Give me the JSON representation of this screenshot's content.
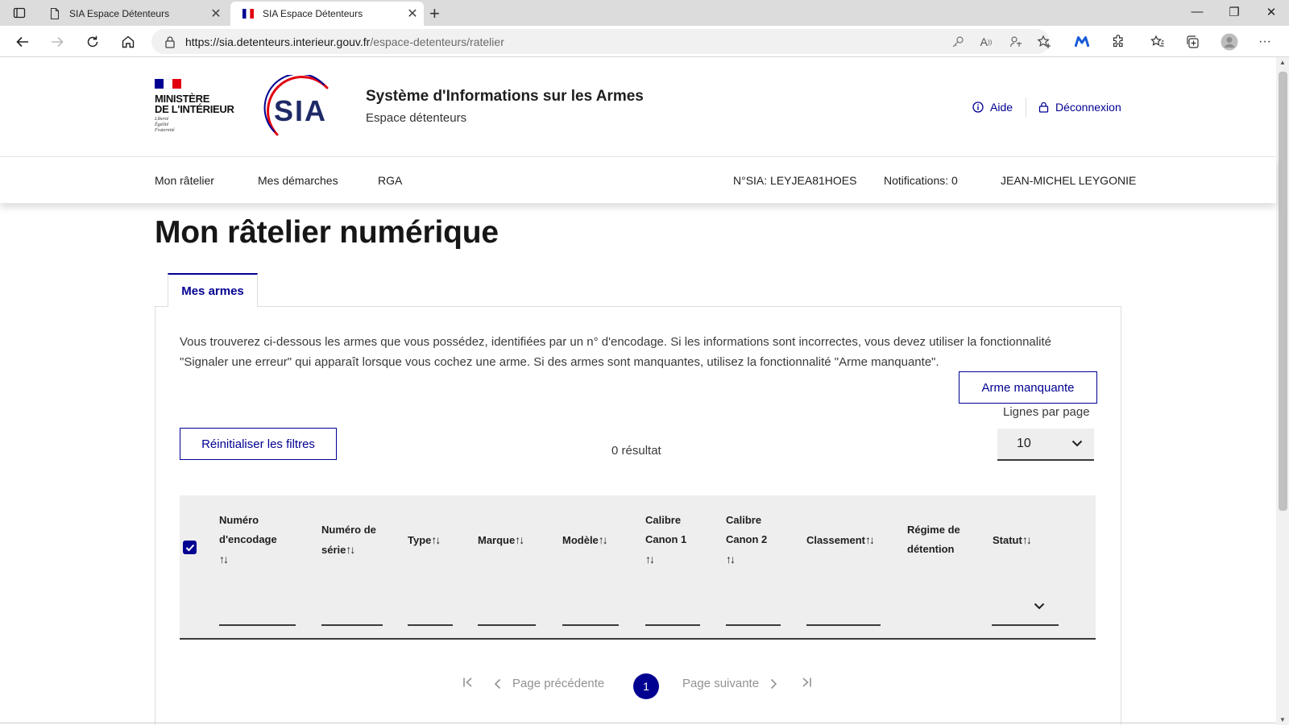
{
  "browser": {
    "tabs": [
      {
        "title": "SIA Espace Détenteurs",
        "active": false
      },
      {
        "title": "SIA Espace Détenteurs",
        "active": true
      }
    ],
    "url_host": "https://sia.detenteurs.interieur.gouv.fr",
    "url_path": "/espace-detenteurs/ratelier"
  },
  "header": {
    "ministere_line1": "MINISTÈRE",
    "ministere_line2": "DE L'INTÉRIEUR",
    "devise1": "Liberté",
    "devise2": "Égalité",
    "devise3": "Fraternité",
    "logo_text": "SIA",
    "title": "Système d'Informations sur les Armes",
    "subtitle": "Espace détenteurs",
    "help_label": "Aide",
    "logout_label": "Déconnexion"
  },
  "nav": {
    "items": [
      "Mon râtelier",
      "Mes démarches",
      "RGA"
    ],
    "sia_number": "N°SIA: LEYJEA81HOES",
    "notifications": "Notifications: 0",
    "user_name": "JEAN-MICHEL LEYGONIE"
  },
  "main": {
    "title": "Mon râtelier numérique",
    "tab_label": "Mes armes",
    "intro": "Vous trouverez ci-dessous les armes que vous possédez, identifiées par un n° d'encodage. Si les informations sont incorrectes, vous devez utiliser la fonctionnalité \"Signaler une erreur\" qui apparaît lorsque vous cochez une arme. Si des armes sont manquantes, utilisez la fonctionnalité \"Arme manquante\".",
    "missing_weapon_button": "Arme manquante",
    "rows_per_page_label": "Lignes par page",
    "rows_per_page_value": "10",
    "reset_filters_button": "Réinitialiser les filtres",
    "results_count": "0 résultat"
  },
  "table": {
    "columns": [
      {
        "l1": "Numéro",
        "l2": "d'encodage",
        "l3": "",
        "sort": true
      },
      {
        "l1": "Numéro de",
        "l2": "série",
        "l3": "",
        "sort": true
      },
      {
        "l1": "Type",
        "l2": "",
        "l3": "",
        "sort": true
      },
      {
        "l1": "Marque",
        "l2": "",
        "l3": "",
        "sort": true
      },
      {
        "l1": "Modèle",
        "l2": "",
        "l3": "",
        "sort": true
      },
      {
        "l1": "Calibre",
        "l2": "Canon 1",
        "l3": "",
        "sort": true
      },
      {
        "l1": "Calibre",
        "l2": "Canon 2",
        "l3": "",
        "sort": true
      },
      {
        "l1": "Classement",
        "l2": "",
        "l3": "",
        "sort": true
      },
      {
        "l1": "Régime de",
        "l2": "détention",
        "l3": "",
        "sort": false
      },
      {
        "l1": "Statut",
        "l2": "",
        "l3": "",
        "sort": true
      }
    ],
    "sort_glyph": "↑↓",
    "select_all_checked": true
  },
  "pagination": {
    "previous_label": "Page précédente",
    "next_label": "Page suivante",
    "current_page": "1"
  },
  "colors": {
    "primary": "#000091",
    "flag_red": "#e1000f",
    "text": "#1e1e1e",
    "table_bg": "#eeeeee"
  }
}
